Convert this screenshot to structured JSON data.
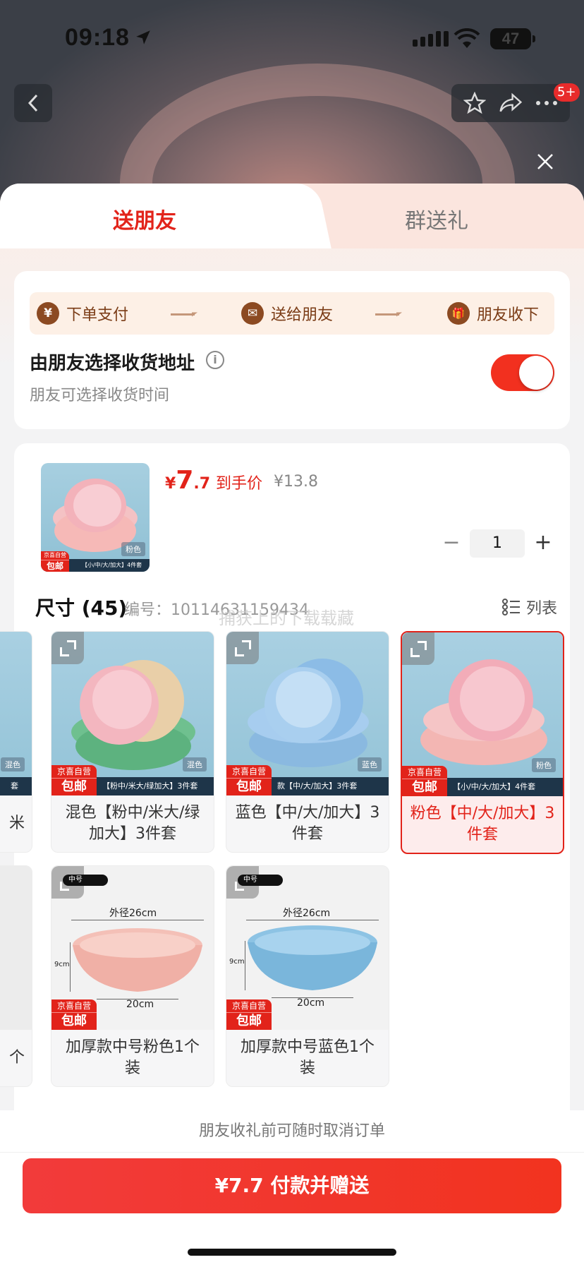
{
  "status_bar": {
    "time": "09:18",
    "battery": "47"
  },
  "nav": {
    "badge": "5+"
  },
  "tabs": [
    {
      "label": "送朋友",
      "active": true
    },
    {
      "label": "群送礼",
      "active": false
    }
  ],
  "flow": {
    "steps": [
      {
        "icon_glyph": "¥",
        "label": "下单支付"
      },
      {
        "icon_glyph": "✉",
        "label": "送给朋友"
      },
      {
        "icon_glyph": "🎁",
        "label": "朋友收下"
      }
    ]
  },
  "address": {
    "title": "由朋友选择收货地址",
    "subtitle": "朋友可选择收货时间",
    "toggle_on": true
  },
  "product": {
    "price_symbol": "¥",
    "price_int": "7",
    "price_dec": ".7",
    "price_tag": "到手价",
    "original_price": "¥13.8",
    "quantity": "1",
    "thumb_chip": "粉色",
    "thumb_strip": "【小/中/大/加大】4件套"
  },
  "spec": {
    "title": "尺寸 (45)",
    "code": "编号：10114631159434",
    "watermark": "捕获上的下载载藏",
    "list_label": "列表"
  },
  "jd_badge": {
    "line1": "京喜自营",
    "line2": "包邮"
  },
  "options": [
    {
      "caption": "米",
      "chip": "混色",
      "strip": "套",
      "selected": false
    },
    {
      "caption": "混色【粉中/米大/绿加大】3件套",
      "chip": "混色",
      "strip": "【粉中/米大/绿加大】3件套",
      "selected": false
    },
    {
      "caption": "蓝色【中/大/加大】3件套",
      "chip": "蓝色",
      "strip": "款【中/大/加大】3件套",
      "selected": false
    },
    {
      "caption": "粉色【中/大/加大】3件套",
      "chip": "粉色",
      "strip": "【小/中/大/加大】4件套",
      "selected": true
    },
    {
      "caption": "个",
      "selected": false
    },
    {
      "caption": "加厚款中号粉色1个装",
      "mini": "中号",
      "dim_outer": "外径26cm",
      "dim_h": "9cm",
      "dim_base": "20cm",
      "selected": false
    },
    {
      "caption": "加厚款中号蓝色1个装",
      "mini": "中号",
      "dim_outer": "外径26cm",
      "dim_h": "9cm",
      "dim_base": "20cm",
      "selected": false
    }
  ],
  "colors": {
    "accent": "#e2231a",
    "toggle": "#f2301f"
  },
  "footer": {
    "note": "朋友收礼前可随时取消订单",
    "pay_label": "¥7.7 付款并赠送"
  }
}
